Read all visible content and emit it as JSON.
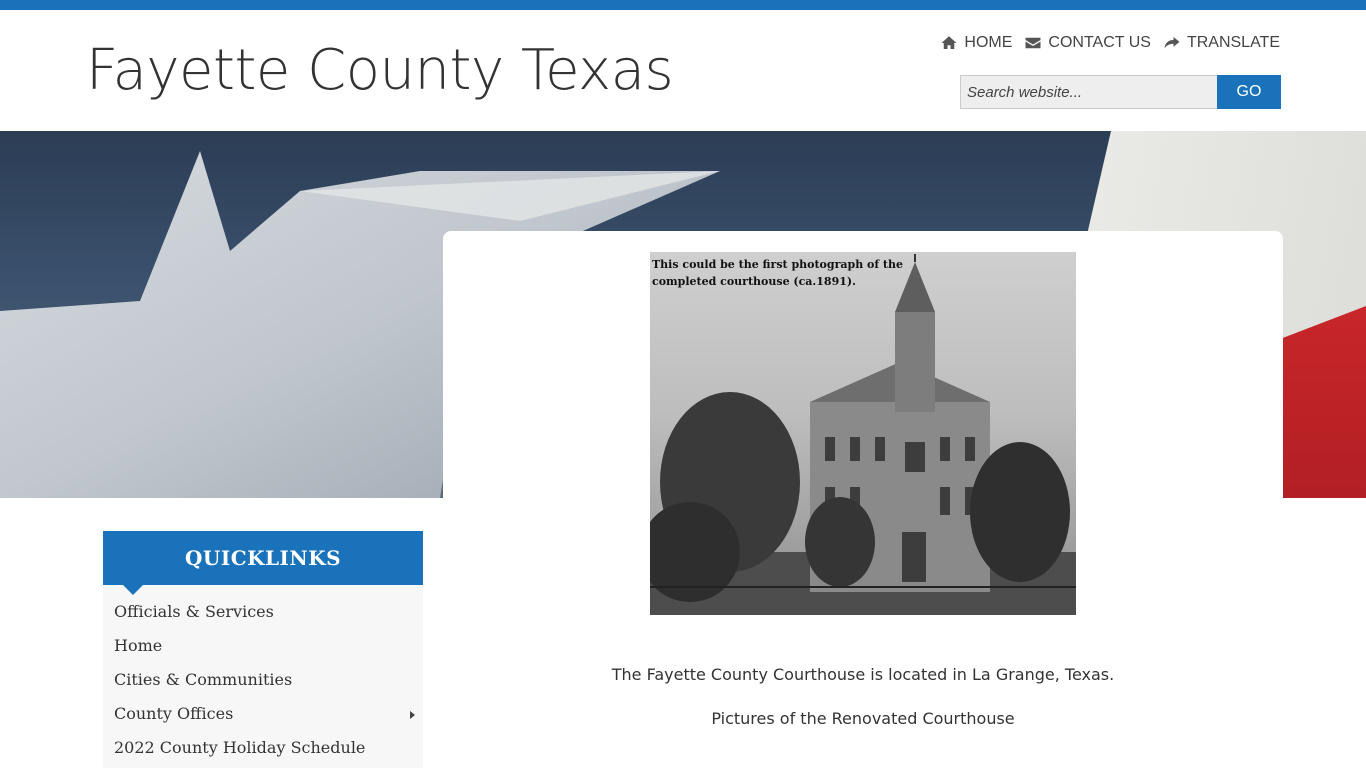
{
  "header": {
    "site_title": "Fayette County Texas",
    "nav": [
      {
        "label": "HOME",
        "icon": "home-icon"
      },
      {
        "label": "CONTACT US",
        "icon": "envelope-icon"
      },
      {
        "label": "TRANSLATE",
        "icon": "share-arrow-icon"
      }
    ],
    "search": {
      "placeholder": "Search website...",
      "value": "",
      "button_label": "GO"
    }
  },
  "main": {
    "photo_caption": "This could be the first photograph of the\ncompleted courthouse (ca.1891).",
    "description": "The Fayette County Courthouse is located in La Grange, Texas.",
    "link_text": "Pictures of the Renovated Courthouse"
  },
  "quicklinks": {
    "title": "QUICKLINKS",
    "items": [
      {
        "label": "Officials & Services",
        "has_submenu": false
      },
      {
        "label": "Home",
        "has_submenu": false
      },
      {
        "label": "Cities & Communities",
        "has_submenu": false
      },
      {
        "label": "County Offices",
        "has_submenu": true
      },
      {
        "label": "2022 County Holiday Schedule",
        "has_submenu": false
      }
    ]
  },
  "colors": {
    "accent": "#1a73ba",
    "banner_blue": "#2c3d55",
    "banner_red": "#c8262a"
  }
}
